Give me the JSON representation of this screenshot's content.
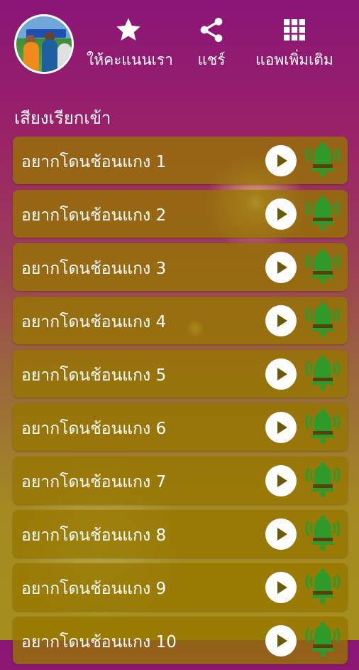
{
  "header": {
    "actions": [
      {
        "label": "ให้คะแนนเรา",
        "icon": "star-icon"
      },
      {
        "label": "แชร์",
        "icon": "share-icon"
      },
      {
        "label": "แอพเพิ่มเติม",
        "icon": "grid-icon"
      }
    ]
  },
  "section": {
    "title": "เสียงเรียกเข้า"
  },
  "ringtones": [
    {
      "title": "อยากโดนช้อนแกง 1"
    },
    {
      "title": "อยากโดนช้อนแกง 2"
    },
    {
      "title": "อยากโดนช้อนแกง 3"
    },
    {
      "title": "อยากโดนช้อนแกง 4"
    },
    {
      "title": "อยากโดนช้อนแกง 5"
    },
    {
      "title": "อยากโดนช้อนแกง 6"
    },
    {
      "title": "อยากโดนช้อนแกง 7"
    },
    {
      "title": "อยากโดนช้อนแกง 8"
    },
    {
      "title": "อยากโดนช้อนแกง 9"
    },
    {
      "title": "อยากโดนช้อนแกง 10"
    }
  ],
  "colors": {
    "bell": "#2f9a2a",
    "row": "#967600"
  }
}
